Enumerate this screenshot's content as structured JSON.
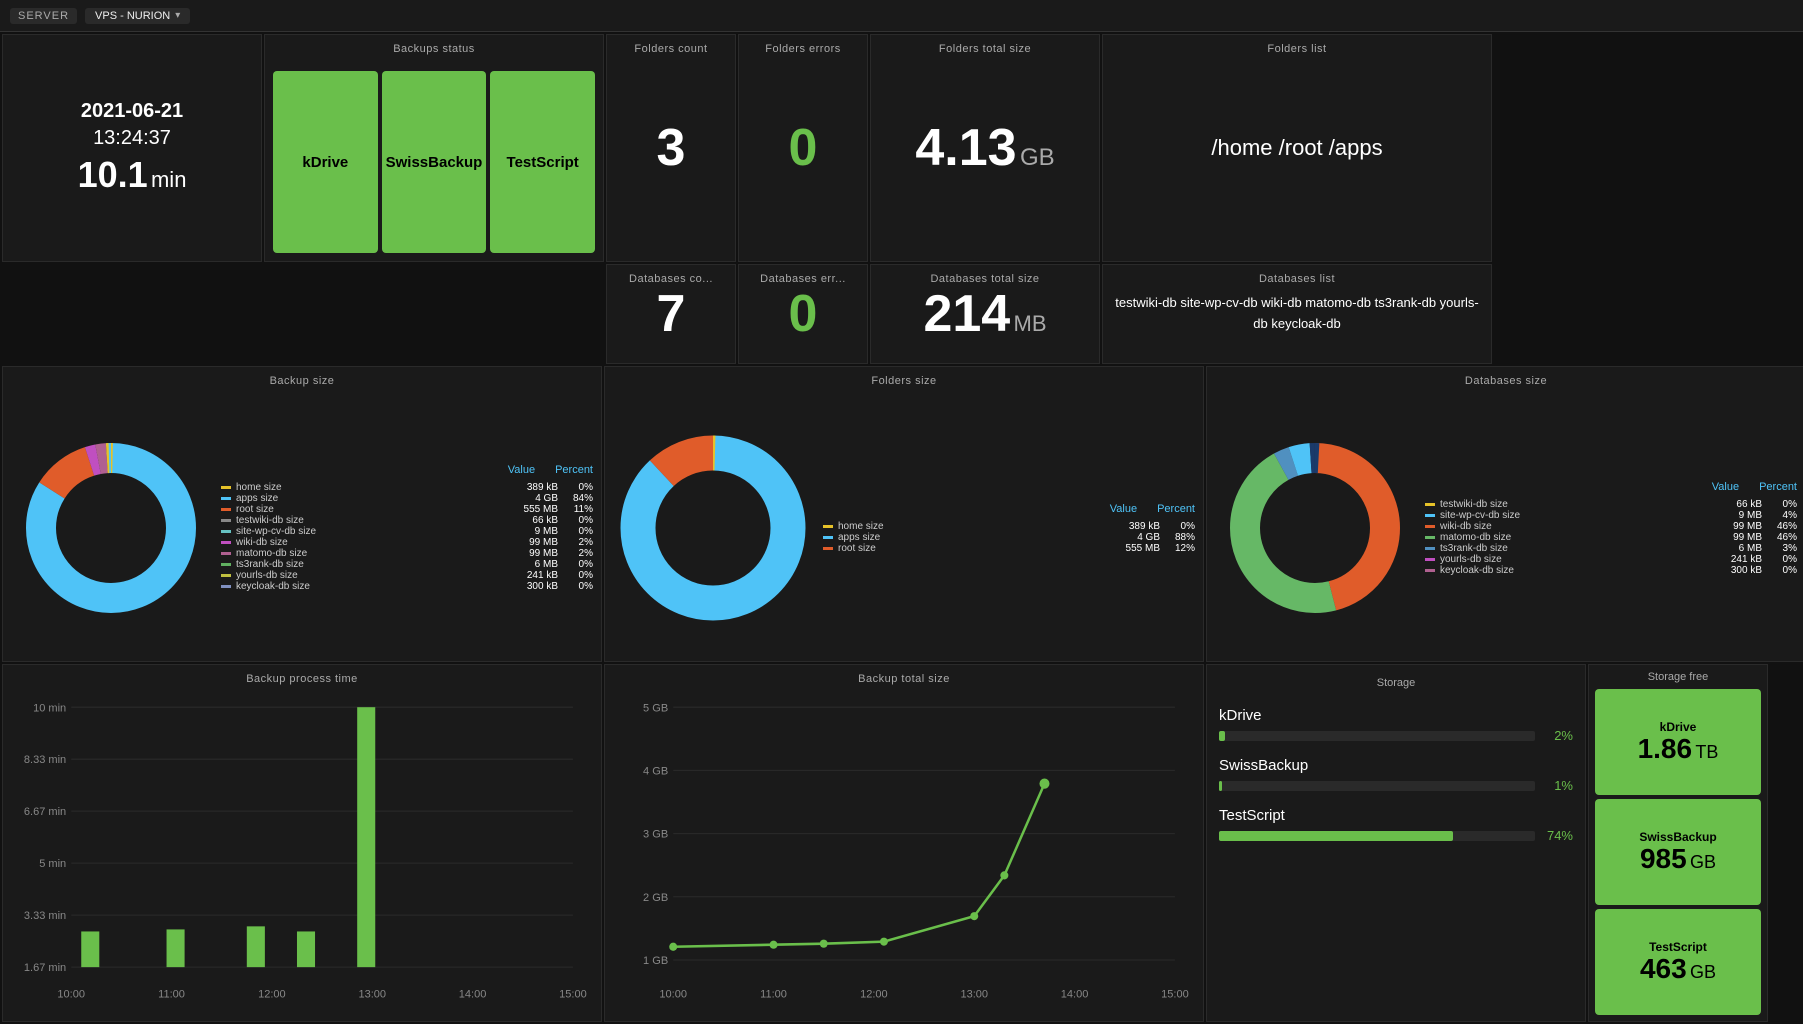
{
  "nav": {
    "server_label": "SERVER",
    "vps_label": "VPS - NURION"
  },
  "time_card": {
    "date": "2021-06-21",
    "clock": "13:24:37",
    "duration": "10.1",
    "duration_unit": "min"
  },
  "backup_status": {
    "title": "Backups status",
    "items": [
      {
        "label": "kDrive",
        "color": "green"
      },
      {
        "label": "SwissBackup",
        "color": "green"
      },
      {
        "label": "TestScript",
        "color": "green"
      }
    ]
  },
  "folders_count": {
    "title": "Folders count",
    "value": "3"
  },
  "folders_errors": {
    "title": "Folders errors",
    "value": "0"
  },
  "folders_total_size": {
    "title": "Folders total size",
    "value": "4.13",
    "unit": "GB"
  },
  "folders_list": {
    "title": "Folders list",
    "value": "/home /root /apps"
  },
  "databases_count": {
    "title": "Databases co...",
    "value": "7"
  },
  "databases_errors": {
    "title": "Databases err...",
    "value": "0"
  },
  "databases_total_size": {
    "title": "Databases total size",
    "value": "214",
    "unit": "MB"
  },
  "databases_list": {
    "title": "Databases list",
    "value": "testwiki-db site-wp-cv-db wiki-db matomo-db ts3rank-db yourls-db keycloak-db"
  },
  "backup_size_chart": {
    "title": "Backup size",
    "legend_value_header": "Value",
    "legend_percent_header": "Percent",
    "items": [
      {
        "name": "home size",
        "color": "#e6c229",
        "value": "389 kB",
        "percent": "0%"
      },
      {
        "name": "apps size",
        "color": "#4fc3f7",
        "value": "4 GB",
        "percent": "84%"
      },
      {
        "name": "root size",
        "color": "#e05c2a",
        "value": "555 MB",
        "percent": "11%"
      },
      {
        "name": "testwiki-db size",
        "color": "#888",
        "value": "66 kB",
        "percent": "0%"
      },
      {
        "name": "site-wp-cv-db size",
        "color": "#66c2c2",
        "value": "9 MB",
        "percent": "0%"
      },
      {
        "name": "wiki-db size",
        "color": "#c04fc0",
        "value": "99 MB",
        "percent": "2%"
      },
      {
        "name": "matomo-db size",
        "color": "#b06090",
        "value": "99 MB",
        "percent": "2%"
      },
      {
        "name": "ts3rank-db size",
        "color": "#60b060",
        "value": "6 MB",
        "percent": "0%"
      },
      {
        "name": "yourls-db size",
        "color": "#c0c040",
        "value": "241 kB",
        "percent": "0%"
      },
      {
        "name": "keycloak-db size",
        "color": "#8090c0",
        "value": "300 kB",
        "percent": "0%"
      }
    ],
    "donut": {
      "segments": [
        {
          "color": "#4fc3f7",
          "pct": 84
        },
        {
          "color": "#e05c2a",
          "pct": 11
        },
        {
          "color": "#c04fc0",
          "pct": 2
        },
        {
          "color": "#b06090",
          "pct": 2
        },
        {
          "color": "#e6c229",
          "pct": 0.5
        },
        {
          "color": "#888",
          "pct": 0.5
        }
      ]
    }
  },
  "folders_size_chart": {
    "title": "Folders size",
    "legend_value_header": "Value",
    "legend_percent_header": "Percent",
    "items": [
      {
        "name": "home size",
        "color": "#e6c229",
        "value": "389 kB",
        "percent": "0%"
      },
      {
        "name": "apps size",
        "color": "#4fc3f7",
        "value": "4 GB",
        "percent": "88%"
      },
      {
        "name": "root size",
        "color": "#e05c2a",
        "value": "555 MB",
        "percent": "12%"
      }
    ],
    "donut": {
      "segments": [
        {
          "color": "#4fc3f7",
          "pct": 88
        },
        {
          "color": "#e05c2a",
          "pct": 12
        },
        {
          "color": "#e6c229",
          "pct": 0.5
        }
      ]
    }
  },
  "databases_size_chart": {
    "title": "Databases size",
    "legend_value_header": "Value",
    "legend_percent_header": "Percent",
    "items": [
      {
        "name": "testwiki-db size",
        "color": "#e6c229",
        "value": "66 kB",
        "percent": "0%"
      },
      {
        "name": "site-wp-cv-db size",
        "color": "#4fc3f7",
        "value": "9 MB",
        "percent": "4%"
      },
      {
        "name": "wiki-db size",
        "color": "#e05c2a",
        "value": "99 MB",
        "percent": "46%"
      },
      {
        "name": "matomo-db size",
        "color": "#66b866",
        "value": "99 MB",
        "percent": "46%"
      },
      {
        "name": "ts3rank-db size",
        "color": "#5090c0",
        "value": "6 MB",
        "percent": "3%"
      },
      {
        "name": "yourls-db size",
        "color": "#c04fc0",
        "value": "241 kB",
        "percent": "0%"
      },
      {
        "name": "keycloak-db size",
        "color": "#b06090",
        "value": "300 kB",
        "percent": "0%"
      }
    ],
    "donut": {
      "segments": [
        {
          "color": "#e05c2a",
          "pct": 46
        },
        {
          "color": "#66b866",
          "pct": 46
        },
        {
          "color": "#5090c0",
          "pct": 4
        },
        {
          "color": "#4fc3f7",
          "pct": 3
        },
        {
          "color": "#1a3a6a",
          "pct": 1
        }
      ]
    }
  },
  "backup_process_time": {
    "title": "Backup process time",
    "y_labels": [
      "10 min",
      "8.33 min",
      "6.67 min",
      "5 min",
      "3.33 min",
      "1.67 min"
    ],
    "x_labels": [
      "10:00",
      "11:00",
      "12:00",
      "13:00",
      "14:00",
      "15:00"
    ],
    "bars": [
      {
        "x": 0.05,
        "height": 0.12
      },
      {
        "x": 0.18,
        "height": 0.12
      },
      {
        "x": 0.31,
        "height": 0.13
      },
      {
        "x": 0.44,
        "height": 0.11
      },
      {
        "x": 0.57,
        "height": 0.95
      }
    ]
  },
  "backup_total_size": {
    "title": "Backup total size",
    "y_labels": [
      "5 GB",
      "4 GB",
      "3 GB",
      "2 GB",
      "1 GB"
    ],
    "x_labels": [
      "10:00",
      "11:00",
      "12:00",
      "13:00",
      "14:00",
      "15:00"
    ],
    "points": [
      {
        "x": 0.0,
        "y": 0.12
      },
      {
        "x": 0.18,
        "y": 0.13
      },
      {
        "x": 0.28,
        "y": 0.13
      },
      {
        "x": 0.38,
        "y": 0.15
      },
      {
        "x": 0.56,
        "y": 0.28
      },
      {
        "x": 0.65,
        "y": 0.52
      },
      {
        "x": 0.75,
        "y": 0.85
      }
    ]
  },
  "storage": {
    "title": "Storage",
    "items": [
      {
        "label": "kDrive",
        "pct": 2,
        "bar_width": "2%"
      },
      {
        "label": "SwissBackup",
        "pct": 1,
        "bar_width": "1%"
      },
      {
        "label": "TestScript",
        "pct": 74,
        "bar_width": "74%"
      }
    ]
  },
  "storage_free": {
    "title": "Storage free",
    "items": [
      {
        "label": "kDrive",
        "value": "1.86",
        "unit": "TB"
      },
      {
        "label": "SwissBackup",
        "value": "985",
        "unit": "GB"
      },
      {
        "label": "TestScript",
        "value": "463",
        "unit": "GB"
      }
    ]
  }
}
